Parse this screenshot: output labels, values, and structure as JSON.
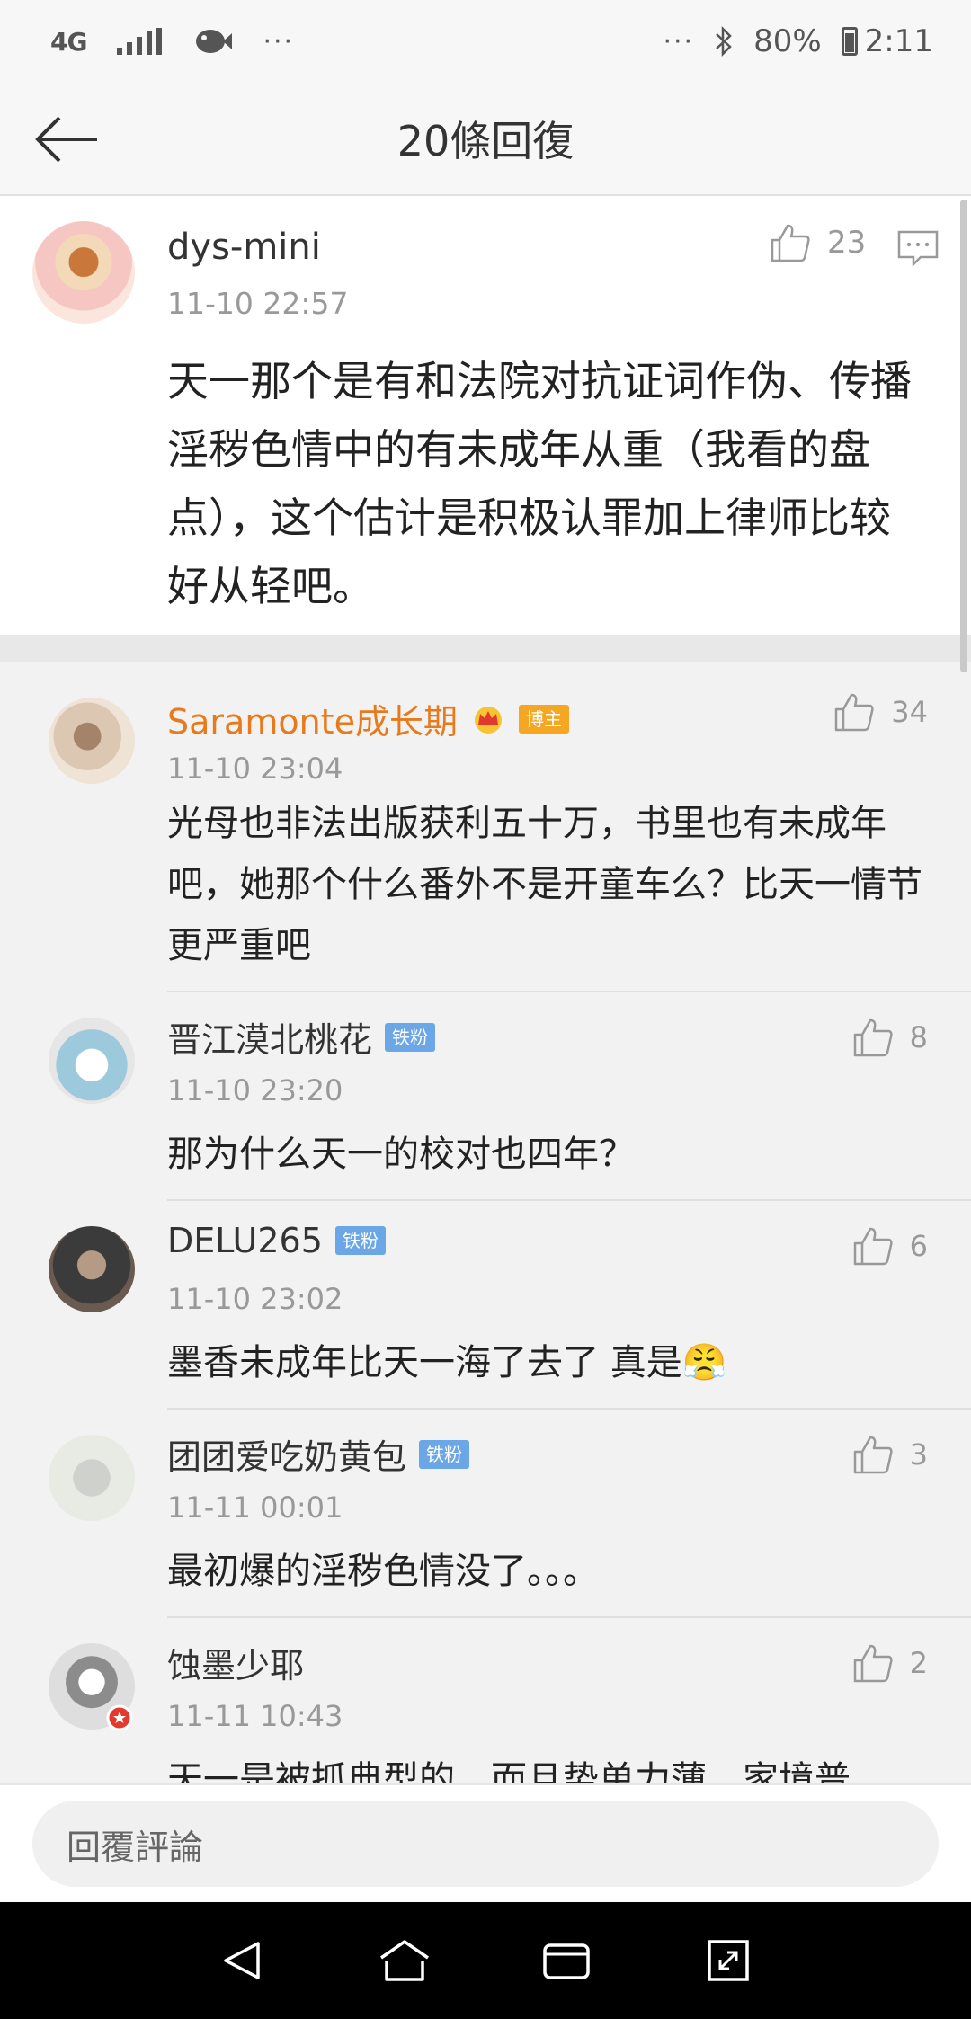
{
  "status_bar": {
    "network": "4G",
    "left_dots": "···",
    "right_dots": "···",
    "battery": "80%",
    "time": "2:11"
  },
  "header": {
    "title": "20條回復"
  },
  "main_comment": {
    "user": "dys-mini",
    "time": "11-10 22:57",
    "likes": "23",
    "text": "天一那个是有和法院对抗证词作伪、传播淫秽色情中的有未成年从重（我看的盘点），这个估计是积极认罪加上律师比较好从轻吧。"
  },
  "replies": [
    {
      "user": "Saramonte成长期",
      "badge": "博主",
      "time": "11-10 23:04",
      "likes": "34",
      "text": "光母也非法出版获利五十万，书里也有未成年吧，她那个什么番外不是开童车么？比天一情节更严重吧"
    },
    {
      "user": "晋江漠北桃花",
      "badge": "铁粉",
      "time": "11-10 23:20",
      "likes": "8",
      "text": "那为什么天一的校对也四年？"
    },
    {
      "user": "DELU265",
      "badge": "铁粉",
      "time": "11-10 23:02",
      "likes": "6",
      "text": "墨香未成年比天一海了去了 真是😤"
    },
    {
      "user": "团团爱吃奶黄包",
      "badge": "铁粉",
      "time": "11-11 00:01",
      "likes": "3",
      "text": "最初爆的淫秽色情没了。。。"
    },
    {
      "user": "蚀墨少耶",
      "time": "11-11 10:43",
      "likes": "2",
      "text": "天一是被抓典型的，而且势单力薄，家境普"
    }
  ],
  "input": {
    "placeholder": "回覆評論"
  },
  "colors": {
    "orange_name": "#e87a1b",
    "badge_blue": "#6ba7e6",
    "badge_orange": "#f5a623"
  }
}
